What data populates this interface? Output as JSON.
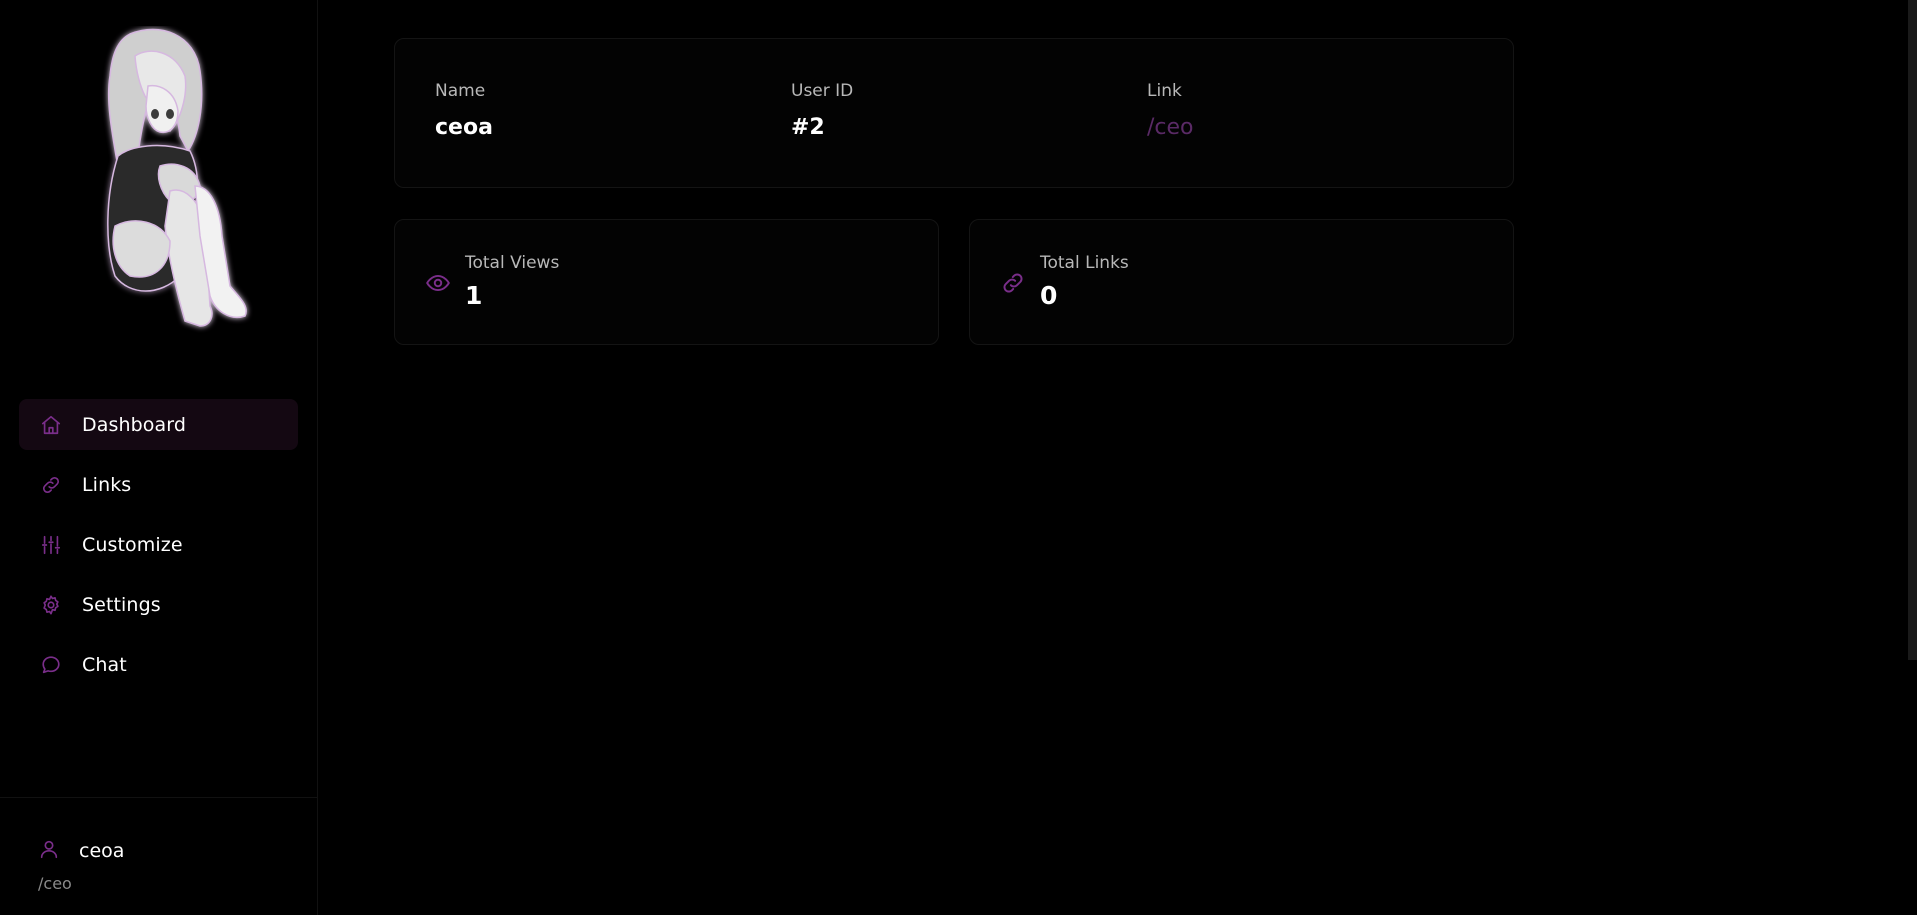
{
  "brand": {
    "accent": "#7a2e8a",
    "background": "#000000"
  },
  "sidebar": {
    "logo": "anime-girl-logo",
    "items": [
      {
        "label": "Dashboard",
        "icon": "home-icon",
        "active": true
      },
      {
        "label": "Links",
        "icon": "link-icon",
        "active": false
      },
      {
        "label": "Customize",
        "icon": "sliders-icon",
        "active": false
      },
      {
        "label": "Settings",
        "icon": "gear-icon",
        "active": false
      },
      {
        "label": "Chat",
        "icon": "chat-icon",
        "active": false
      }
    ],
    "user": {
      "name": "ceoa",
      "link": "/ceo",
      "icon": "user-icon"
    }
  },
  "profile": {
    "name_label": "Name",
    "name_value": "ceoa",
    "userid_label": "User ID",
    "userid_value": "#2",
    "link_label": "Link",
    "link_value": "/ceo"
  },
  "stats": {
    "views_label": "Total Views",
    "views_value": "1",
    "views_icon": "eye-icon",
    "links_label": "Total Links",
    "links_value": "0",
    "links_icon": "link-icon"
  }
}
